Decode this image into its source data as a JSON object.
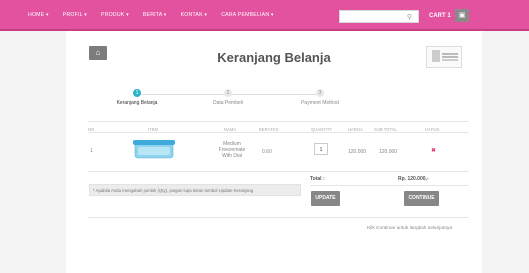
{
  "nav": {
    "items": [
      "HOME",
      "PROFIL",
      "PRODUK",
      "BERITA",
      "KONTAK",
      "CARA PEMBELIAN"
    ],
    "search_placeholder": "",
    "cart_label": "CART 1"
  },
  "page": {
    "title": "Keranjang Belanja"
  },
  "steps": [
    {
      "number": "1",
      "label": "Keranjang Belanja"
    },
    {
      "number": "2",
      "label": "Data Pembeli"
    },
    {
      "number": "3",
      "label": "Payment Method"
    }
  ],
  "table": {
    "headers": [
      "NO.",
      "ITEM",
      "NAMA",
      "BERATKG",
      "QUANTITY",
      "HARGA",
      "SUB TOTAL",
      "HAPUS"
    ],
    "rows": [
      {
        "no": "1",
        "name": "Medium Freezemate With Dial",
        "weight": "0.60",
        "qty": "1",
        "price": "120.000",
        "subtotal": "120.000"
      }
    ]
  },
  "note": "* Apabila Anda mengubah jumlah (Qty), jangan lupa tekan tombol Update Keranjang",
  "totals": {
    "label": "Total :",
    "value": "Rp. 120.000,-"
  },
  "buttons": {
    "update": "UPDATE",
    "continue": "CONTINUE"
  },
  "hint": "Klik Continue untuk langkah selanjutnya",
  "colors": {
    "brand": "#e2529f",
    "step_active": "#2ab3c9",
    "button": "#878787",
    "remove": "#e03b6d"
  }
}
